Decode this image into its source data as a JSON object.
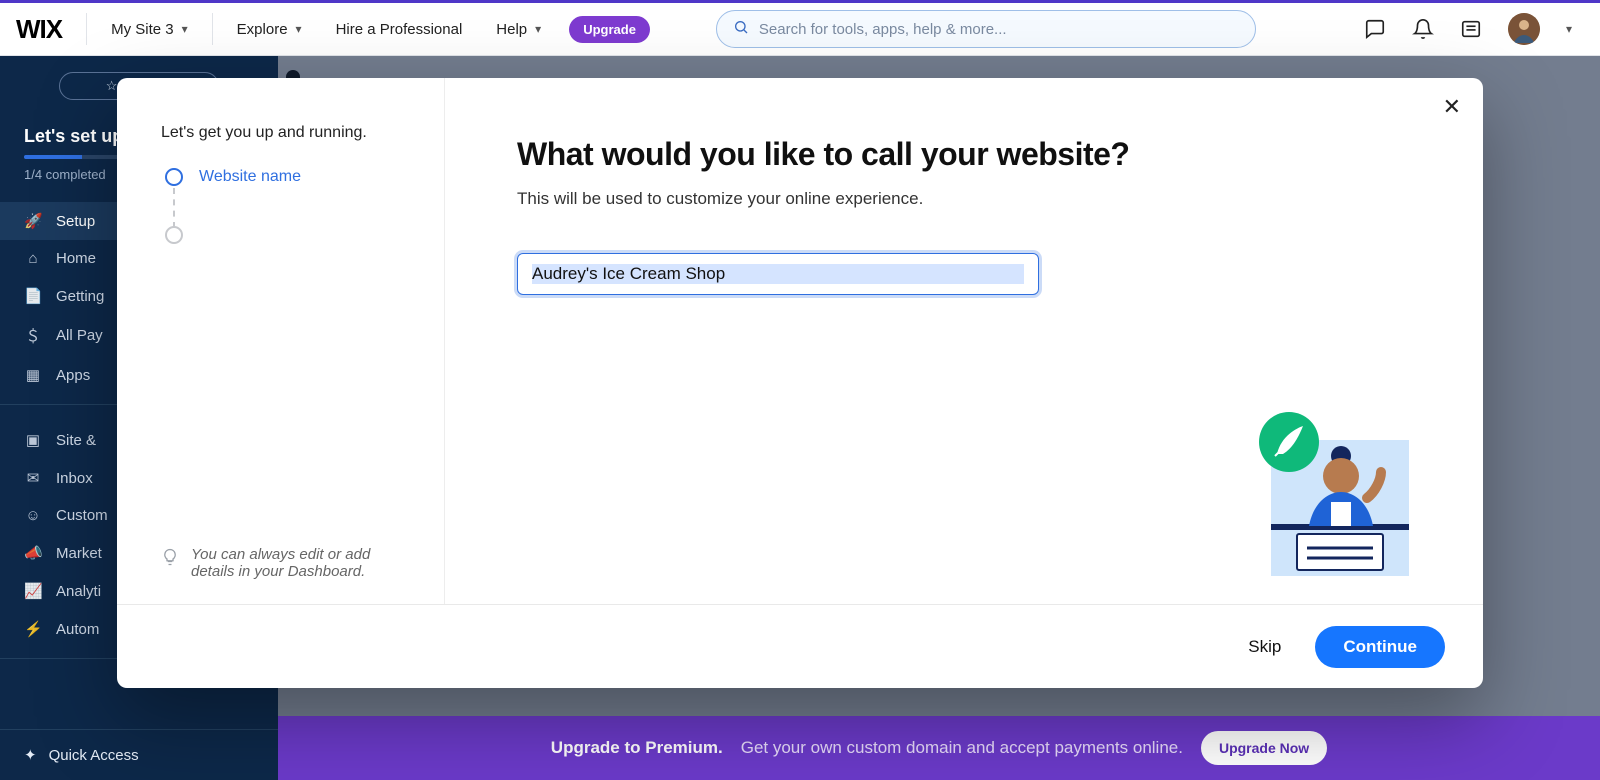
{
  "header": {
    "brand": "WIX",
    "site_selector": "My Site 3",
    "nav": {
      "explore": "Explore",
      "hire": "Hire a Professional",
      "help": "Help"
    },
    "upgrade_pill": "Upgrade",
    "search_placeholder": "Search for tools, apps, help & more..."
  },
  "sidebar": {
    "favorite": "Favorite",
    "setup_title": "Let's set up",
    "progress_label": "1/4 completed",
    "items": [
      {
        "icon": "rocket",
        "label": "Setup",
        "active": true
      },
      {
        "icon": "home",
        "label": "Home"
      },
      {
        "icon": "page",
        "label": "Getting"
      },
      {
        "icon": "dollar",
        "label": "All Pay"
      },
      {
        "icon": "grid",
        "label": "Apps"
      }
    ],
    "items2": [
      {
        "icon": "layout",
        "label": "Site & "
      },
      {
        "icon": "mail",
        "label": "Inbox"
      },
      {
        "icon": "user",
        "label": "Custom"
      },
      {
        "icon": "mega",
        "label": "Market"
      },
      {
        "icon": "chart",
        "label": "Analyti"
      },
      {
        "icon": "bolt",
        "label": "Autom"
      }
    ],
    "quick_access": "Quick Access"
  },
  "banner": {
    "lead": "Upgrade to Premium.",
    "rest": "Get your own custom domain and accept payments online.",
    "cta": "Upgrade Now"
  },
  "modal": {
    "side_heading": "Let's get you up and running.",
    "step1": "Website name",
    "hint": "You can always edit or add details in your Dashboard.",
    "title": "What would you like to call your website?",
    "subtitle": "This will be used to customize your online experience.",
    "input_value": "Audrey's Ice Cream Shop",
    "skip": "Skip",
    "continue": "Continue"
  }
}
